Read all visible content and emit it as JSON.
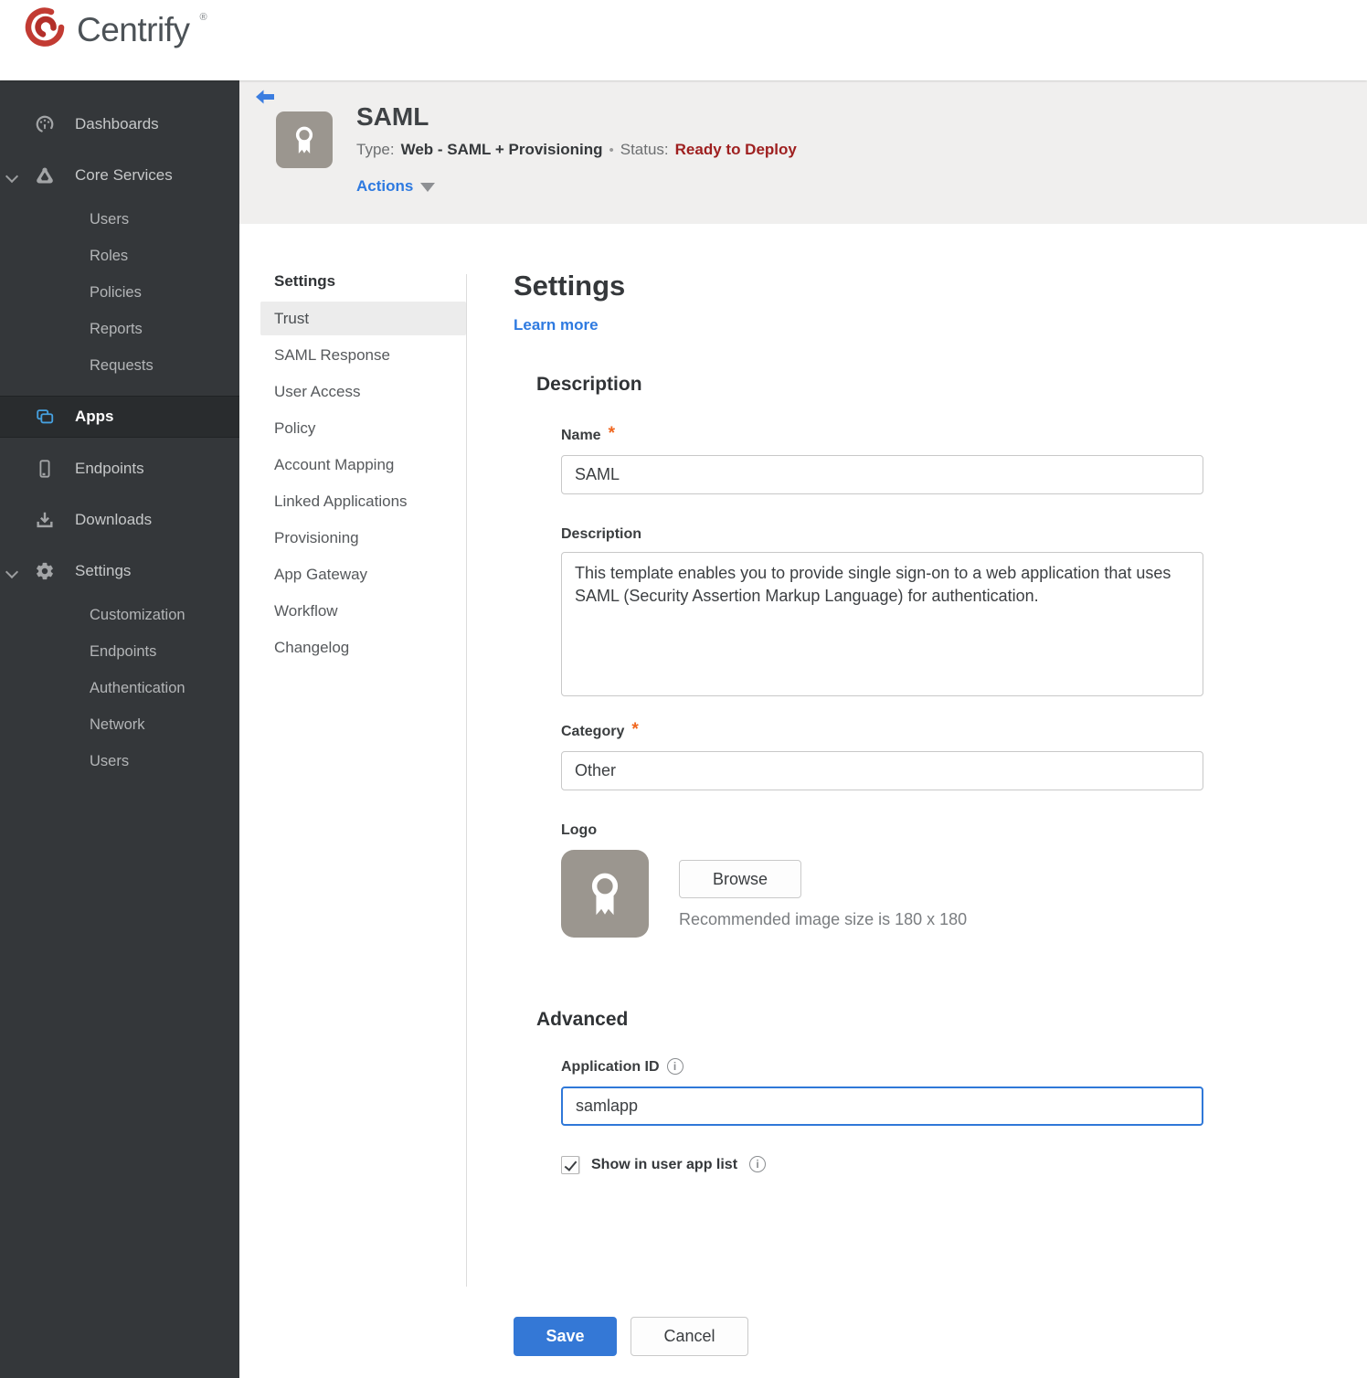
{
  "brand": {
    "name": "Centrify",
    "registered": "®",
    "logo_red": "#c23b33"
  },
  "sidebar": {
    "dashboards": "Dashboards",
    "core_services": "Core Services",
    "core_children": [
      "Users",
      "Roles",
      "Policies",
      "Reports",
      "Requests"
    ],
    "apps": "Apps",
    "endpoints": "Endpoints",
    "downloads": "Downloads",
    "settings": "Settings",
    "settings_children": [
      "Customization",
      "Endpoints",
      "Authentication",
      "Network",
      "Users"
    ]
  },
  "app_header": {
    "title": "SAML",
    "type_label": "Type:",
    "type_value": "Web - SAML + Provisioning",
    "separator": "•",
    "status_label": "Status:",
    "status_value": "Ready to Deploy",
    "actions_label": "Actions"
  },
  "subnav": {
    "heading": "Settings",
    "selected": "Trust",
    "items": [
      "Trust",
      "SAML Response",
      "User Access",
      "Policy",
      "Account Mapping",
      "Linked Applications",
      "Provisioning",
      "App Gateway",
      "Workflow",
      "Changelog"
    ]
  },
  "main": {
    "title": "Settings",
    "learn_more": "Learn more",
    "description_section": {
      "heading": "Description",
      "name_label": "Name",
      "name_value": "SAML",
      "description_label": "Description",
      "description_value": "This template enables you to provide single sign-on to a web application that uses SAML (Security Assertion Markup Language) for authentication.",
      "category_label": "Category",
      "category_value": "Other",
      "logo_label": "Logo",
      "browse_label": "Browse",
      "logo_hint": "Recommended image size is 180 x 180"
    },
    "advanced_section": {
      "heading": "Advanced",
      "app_id_label": "Application ID",
      "app_id_value": "samlapp",
      "show_in_app_list_label": "Show in user app list",
      "show_in_app_list_checked": true
    },
    "footer": {
      "save_label": "Save",
      "cancel_label": "Cancel"
    }
  },
  "colors": {
    "accent_blue": "#2e7ae0",
    "save_blue": "#3478d6",
    "status_red": "#9e1f1f",
    "asterisk_orange": "#f0661e",
    "sidebar_bg": "#34373a",
    "header_band_bg": "#f0efee",
    "app_icon_gray": "#9b968f"
  }
}
